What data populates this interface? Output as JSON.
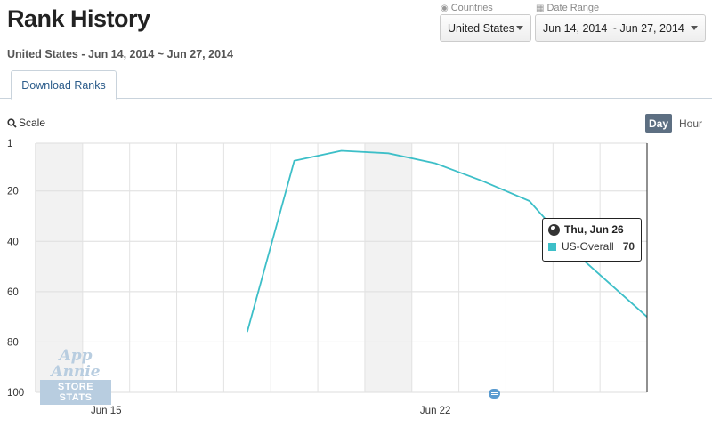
{
  "header": {
    "title": "Rank History",
    "subtitle": "United States - Jun 14, 2014 ~ Jun 27, 2014"
  },
  "filters": {
    "countries": {
      "label": "Countries",
      "value": "United States",
      "icon": "globe-icon"
    },
    "date_range": {
      "label": "Date Range",
      "value": "Jun 14, 2014 ~ Jun 27, 2014",
      "icon": "calendar-icon"
    }
  },
  "tabs": [
    {
      "label": "Download Ranks",
      "active": true
    }
  ],
  "controls": {
    "scale_label": "Scale",
    "day_label": "Day",
    "hour_label": "Hour",
    "active_granularity": "Day"
  },
  "chart_data": {
    "type": "line",
    "y_reversed": true,
    "ylim": [
      1,
      100
    ],
    "y_ticks": [
      "1",
      "20",
      "40",
      "60",
      "80",
      "100"
    ],
    "y_tick_values": [
      1,
      20,
      40,
      60,
      80,
      100
    ],
    "x_dates": [
      "Jun 14",
      "Jun 15",
      "Jun 16",
      "Jun 17",
      "Jun 18",
      "Jun 19",
      "Jun 20",
      "Jun 21",
      "Jun 22",
      "Jun 23",
      "Jun 24",
      "Jun 25",
      "Jun 26"
    ],
    "x_tick_labels": [
      "Jun 15",
      "Jun 22"
    ],
    "weekend_days": [
      "Jun 14",
      "Jun 21"
    ],
    "series": [
      {
        "name": "US-Overall",
        "color": "#3dbfc8",
        "x": [
          "Jun 18",
          "Jun 19",
          "Jun 20",
          "Jun 21",
          "Jun 22",
          "Jun 23",
          "Jun 24",
          "Jun 25",
          "Jun 26"
        ],
        "values": [
          76,
          8,
          4,
          5,
          9,
          16,
          24,
          45,
          70
        ]
      }
    ],
    "grid": true
  },
  "tooltip": {
    "date": "Thu, Jun 26",
    "series": "US-Overall",
    "value": "70",
    "color": "#3dbfc8"
  },
  "watermark": {
    "top": "App Annie",
    "bottom": "STORE STATS"
  }
}
